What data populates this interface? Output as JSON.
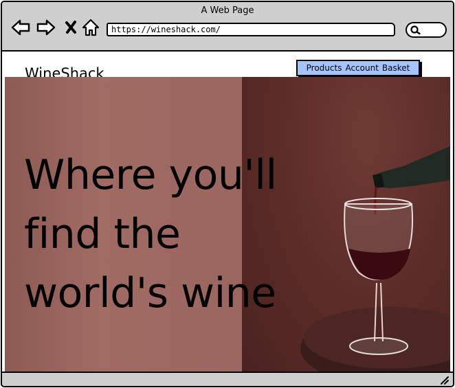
{
  "window": {
    "title": "A Web Page",
    "url": "https://wineshack.com/"
  },
  "toolbar": {
    "icons": [
      "back-arrow-icon",
      "forward-arrow-icon",
      "close-x-icon",
      "home-icon",
      "search-icon"
    ]
  },
  "site": {
    "logo": "WineShack",
    "nav": [
      "Products",
      "Account",
      "Basket"
    ]
  },
  "hero": {
    "lines": [
      "Where you'll",
      "find the",
      "world's wine"
    ],
    "image": "wine-pouring-into-glass-photo"
  },
  "colors": {
    "chrome": "#cfcfcf",
    "menu": "#a3c4ff",
    "hero_left": "#9b6660",
    "hero_right": "#5a2b27"
  }
}
